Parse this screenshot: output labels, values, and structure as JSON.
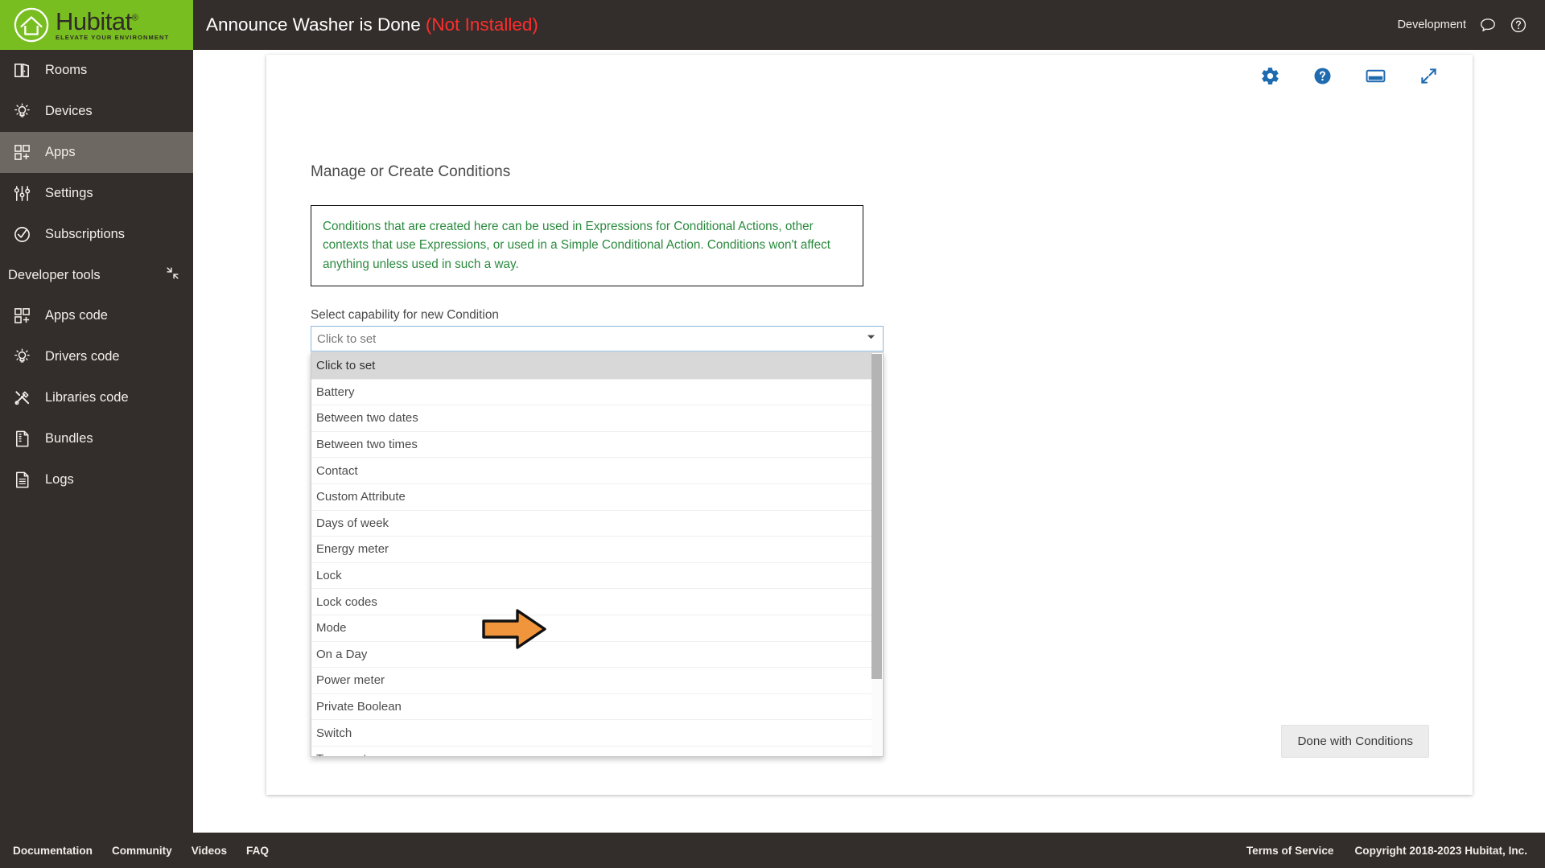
{
  "brand": {
    "name": "Hubitat",
    "registered": "®",
    "tagline": "ELEVATE YOUR ENVIRONMENT",
    "green": "#78be20",
    "dark": "#332e2b"
  },
  "topbar": {
    "app_title": "Announce Washer is Done",
    "status": "(Not Installed)",
    "status_color": "#ff2d2d",
    "environment": "Development",
    "chat_icon": "chat-bubble-icon",
    "help_icon": "question-circle-icon"
  },
  "sidebar": {
    "items": [
      {
        "label": "Rooms",
        "icon": "rooms-door-icon",
        "active": false
      },
      {
        "label": "Devices",
        "icon": "lightbulb-icon",
        "active": false
      },
      {
        "label": "Apps",
        "icon": "apps-grid-plus-icon",
        "active": true
      },
      {
        "label": "Settings",
        "icon": "sliders-icon",
        "active": false
      },
      {
        "label": "Subscriptions",
        "icon": "check-circle-icon",
        "active": false
      }
    ],
    "developer_section": {
      "label": "Developer tools",
      "collapse_icon": "collapse-arrows-icon",
      "items": [
        {
          "label": "Apps code",
          "icon": "apps-grid-plus-icon"
        },
        {
          "label": "Drivers code",
          "icon": "lightbulb-icon"
        },
        {
          "label": "Libraries code",
          "icon": "tools-cross-icon"
        },
        {
          "label": "Bundles",
          "icon": "zip-file-icon"
        },
        {
          "label": "Logs",
          "icon": "document-lines-icon"
        }
      ]
    }
  },
  "card_toolbar": {
    "icons": [
      {
        "name": "gear-icon",
        "color": "#1f6bb0"
      },
      {
        "name": "question-circle-icon",
        "color": "#1f6bb0"
      },
      {
        "name": "display-monitor-icon",
        "color": "#1f6bb0"
      },
      {
        "name": "expand-fullscreen-icon",
        "color": "#1f6bb0"
      }
    ]
  },
  "main": {
    "panel_title": "Manage or Create Conditions",
    "info_note": "Conditions that are created here can be used in Expressions for Conditional Actions, other contexts that use Expressions, or used in a Simple Conditional Action.  Conditions won't affect anything unless used in such a way.",
    "info_note_color": "#2a8a3e",
    "select_label": "Select capability for new Condition",
    "select_value": "Click to set",
    "select_placeholder": "Click to set",
    "dropdown_open": true,
    "dropdown_options": [
      "Click to set",
      "Battery",
      "Between two dates",
      "Between two times",
      "Contact",
      "Custom Attribute",
      "Days of week",
      "Energy meter",
      "Lock",
      "Lock codes",
      "Mode",
      "On a Day",
      "Power meter",
      "Private Boolean",
      "Switch",
      "Temperature"
    ],
    "dropdown_selected": "Click to set",
    "annotation_arrow": {
      "points_to": "Mode",
      "fill": "#f0953c",
      "stroke": "#111111"
    },
    "done_button": "Done with Conditions"
  },
  "footer": {
    "links": [
      "Documentation",
      "Community",
      "Videos",
      "FAQ"
    ],
    "terms": "Terms of Service",
    "copyright": "Copyright 2018-2023 Hubitat, Inc."
  }
}
